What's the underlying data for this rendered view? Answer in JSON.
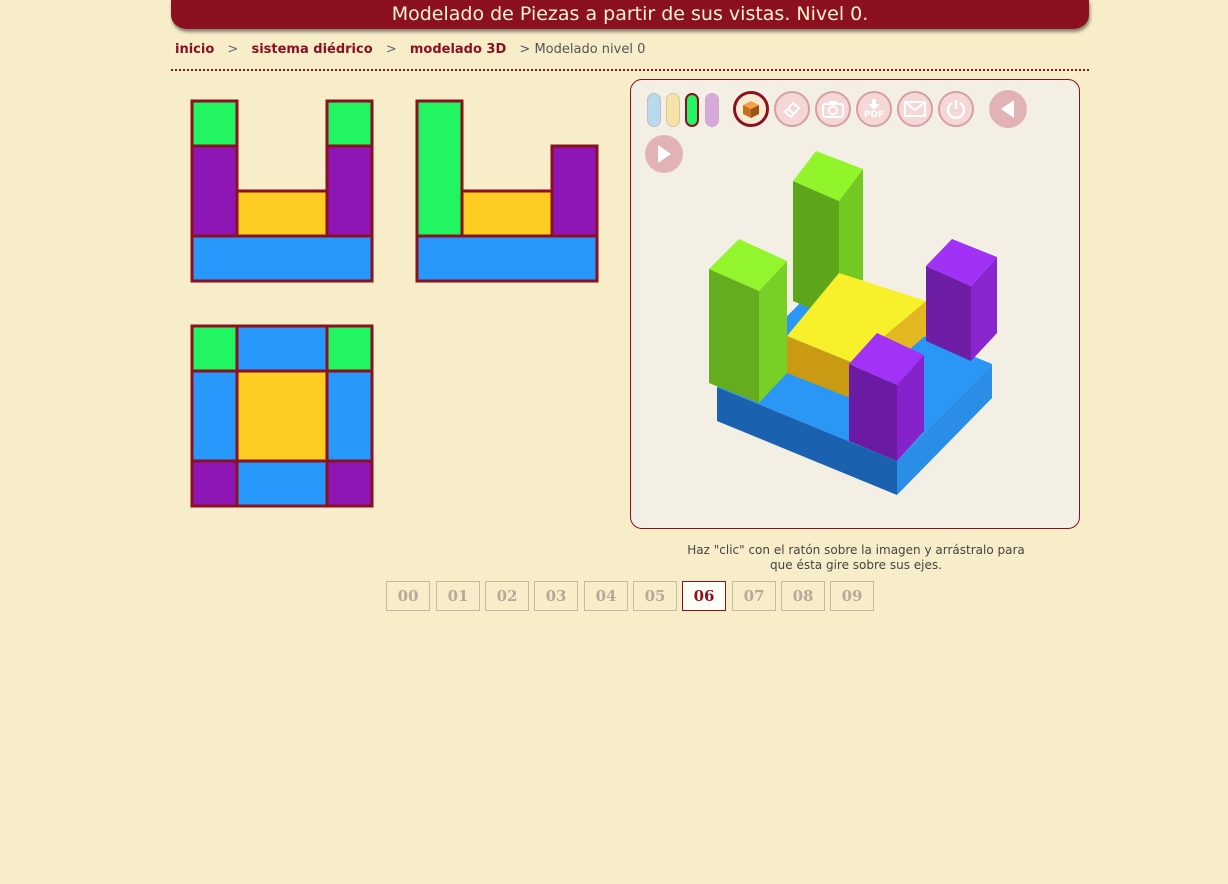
{
  "header": {
    "title": "Modelado de Piezas a partir de sus vistas. Nivel 0."
  },
  "breadcrumb": {
    "home": "inicio",
    "section": "sistema diédrico",
    "subsection": "modelado 3D",
    "current": "> Modelado nivel 0",
    "separator": ">"
  },
  "colors": {
    "accent": "#8b1020",
    "green": "#22f562",
    "purple": "#8e16b4",
    "yellow": "#ffcc22",
    "blue": "#2898fc"
  },
  "toolbar": {
    "color_pills": [
      "blue",
      "yellow",
      "green",
      "purple"
    ],
    "selected_pill": "green",
    "tools": [
      {
        "name": "cube-icon",
        "active": true
      },
      {
        "name": "eraser-icon",
        "active": false
      },
      {
        "name": "camera-icon",
        "active": false
      },
      {
        "name": "pdf-download-icon",
        "label": "PDF",
        "active": false
      },
      {
        "name": "mail-icon",
        "active": false
      },
      {
        "name": "power-icon",
        "active": false
      }
    ],
    "prev": "triangle-left-icon",
    "next": "triangle-right-icon"
  },
  "caption": {
    "line1": "Haz \"clic\" con el ratón sobre la imagen y arrástralo para",
    "line2": "que ésta gire sobre sus ejes."
  },
  "pager": {
    "pages": [
      "00",
      "01",
      "02",
      "03",
      "04",
      "05",
      "06",
      "07",
      "08",
      "09"
    ],
    "active": "06"
  }
}
